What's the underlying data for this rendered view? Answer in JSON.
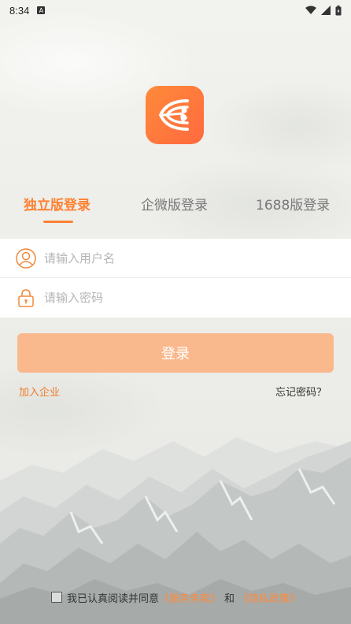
{
  "status_bar": {
    "time": "8:34",
    "notification_letter": "A"
  },
  "tabs": [
    {
      "label": "独立版登录",
      "active": true
    },
    {
      "label": "企微版登录",
      "active": false
    },
    {
      "label": "1688版登录",
      "active": false
    }
  ],
  "form": {
    "username_placeholder": "请输入用户名",
    "password_placeholder": "请输入密码"
  },
  "login_button_label": "登录",
  "join_company_link": "加入企业",
  "forgot_password_link": "忘记密码？",
  "agreement": {
    "prefix": "我已认真阅读并同意",
    "terms_link": "《服务条款》",
    "and": "和",
    "privacy_link": "《隐私政策》"
  },
  "colors": {
    "accent": "#ff8132",
    "button_bg": "#f9b98d",
    "logo_bg": "#ff7a3c"
  }
}
